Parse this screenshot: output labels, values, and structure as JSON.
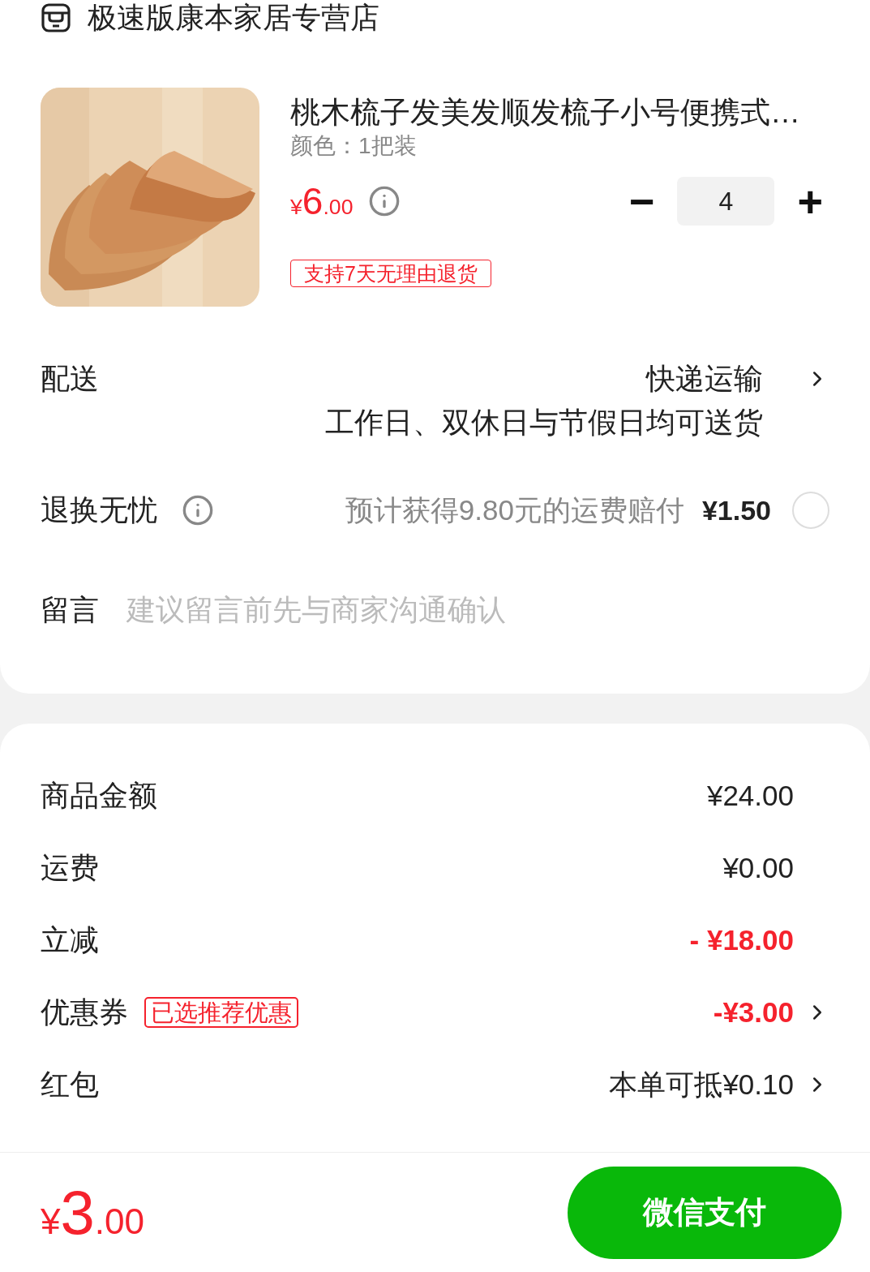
{
  "store": {
    "name": "极速版康本家居专营店"
  },
  "product": {
    "title": "桃木梳子发美发顺发梳子小号便携式…",
    "spec": "颜色：1把装",
    "price": {
      "currency": "¥",
      "integer": "6",
      "decimal": ".00"
    },
    "quantity": "4",
    "minus": "−",
    "plus": "+",
    "tag": "支持7天无理由退货"
  },
  "delivery": {
    "label": "配送",
    "method": "快递运输",
    "note": "工作日、双休日与节假日均可送货"
  },
  "return_insurance": {
    "label": "退换无忧",
    "description": "预计获得9.80元的运费赔付",
    "price": "¥1.50",
    "checked": false
  },
  "message": {
    "label": "留言",
    "placeholder": "建议留言前先与商家沟通确认"
  },
  "summary": [
    {
      "label": "商品金额",
      "value": "¥24.00",
      "negative": false,
      "chevron": false
    },
    {
      "label": "运费",
      "value": "¥0.00",
      "negative": false,
      "chevron": false
    },
    {
      "label": "立减",
      "value": "- ¥18.00",
      "negative": true,
      "chevron": false
    },
    {
      "label": "优惠券",
      "tag": "已选推荐优惠",
      "value": "-¥3.00",
      "negative": true,
      "chevron": true
    },
    {
      "label": "红包",
      "value": "本单可抵¥0.10",
      "negative": false,
      "chevron": true
    }
  ],
  "footer": {
    "total": {
      "currency": "¥",
      "integer": "3",
      "decimal": ".00"
    },
    "pay_button": "微信支付"
  }
}
